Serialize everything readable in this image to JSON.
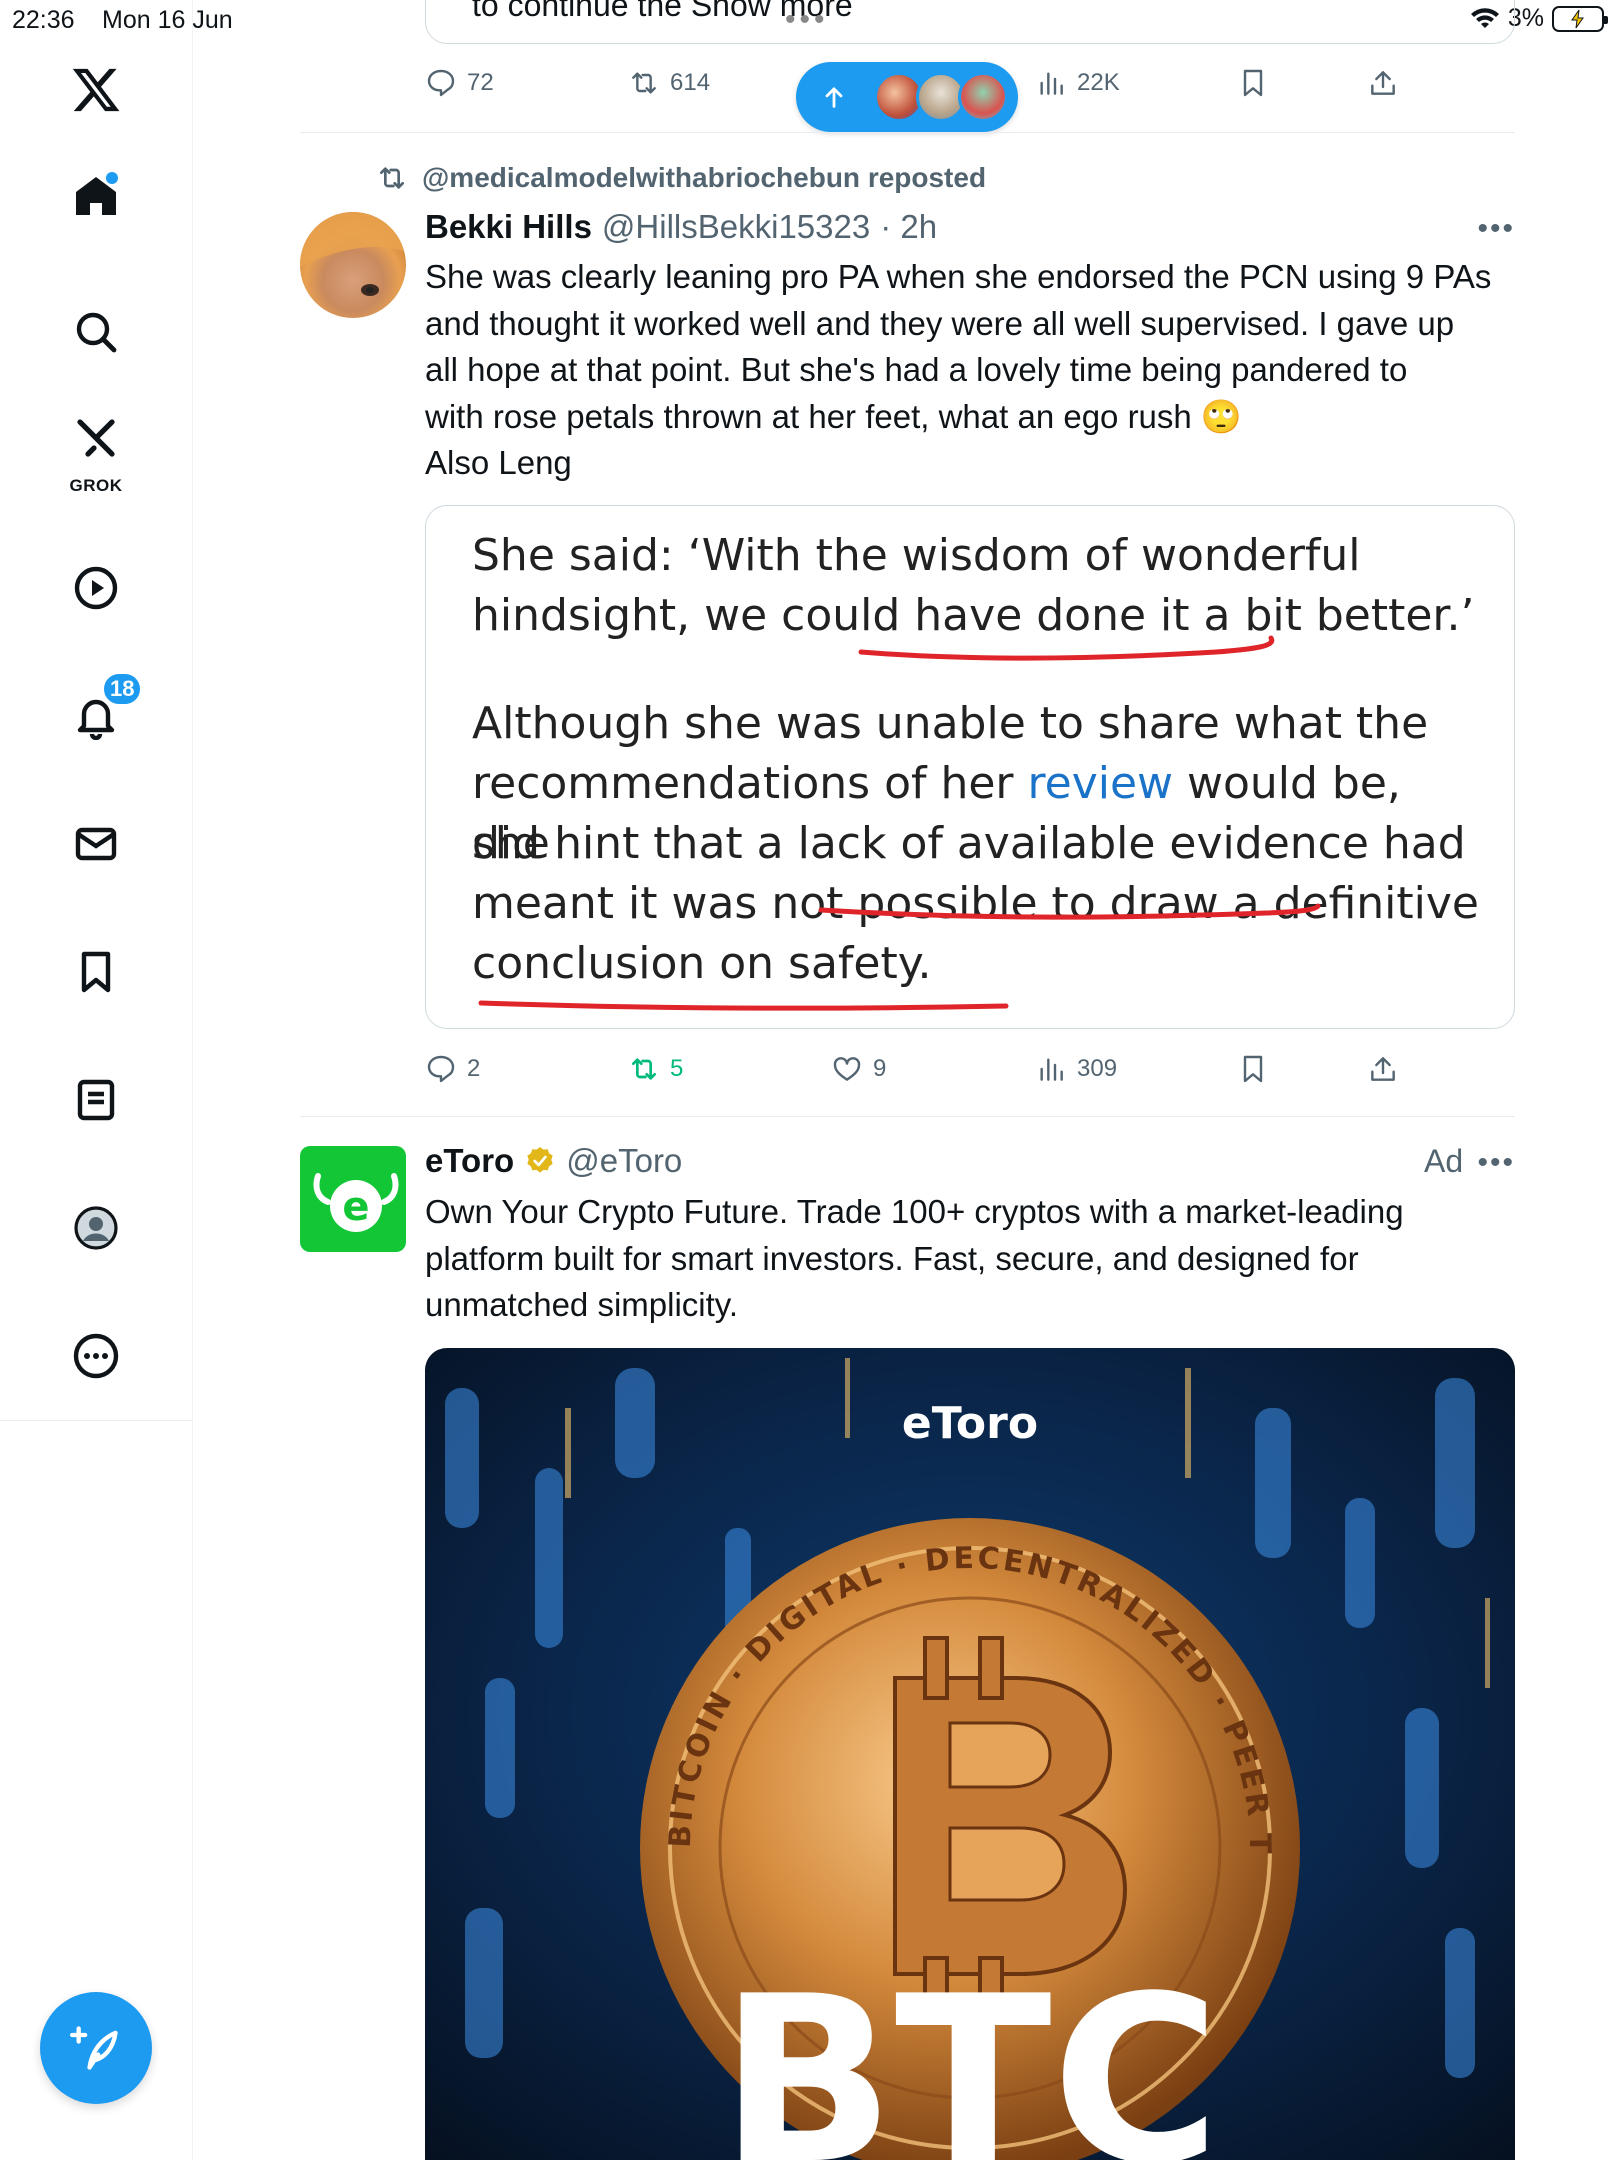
{
  "status_bar": {
    "time": "22:36",
    "date": "Mon 16 Jun",
    "battery": "3%"
  },
  "sidebar": {
    "grok_label": "GROK",
    "notifications_badge": "18",
    "items": [
      "home",
      "search",
      "grok",
      "videos",
      "notifications",
      "messages",
      "bookmarks",
      "lists",
      "profile",
      "more"
    ]
  },
  "top_tweet": {
    "truncated_text": "to continue the Show more",
    "reply_count": "72",
    "repost_count": "614",
    "view_count": "22K"
  },
  "reposted_tweet": {
    "repost_by": "@medicalmodelwithabriochebun reposted",
    "author_name": "Bekki Hills",
    "author_handle": "@HillsBekki15323",
    "time": "· 2h",
    "text_lines": [
      "She was clearly leaning pro PA when she endorsed the PCN using 9 PAs",
      "and thought it worked well and they were all well supervised. I gave up",
      "all hope at that point. But she's had a lovely time being pandered to",
      "with rose petals thrown at her feet, what an ego rush 🙄",
      "Also Leng"
    ],
    "quote_image": {
      "para1_lines": [
        "She said: ‘With the wisdom of wonderful",
        "hindsight, we could have done it a bit better.’"
      ],
      "para2_line1": "Although she was unable to share what the",
      "para2_line2_before": "recommendations of her ",
      "para2_link": "review",
      "para2_line2_after": " would be, she",
      "para2_line3": "did hint that a lack of available evidence had",
      "para2_line4": "meant it was not possible to draw a definitive",
      "para2_line5": "conclusion on safety."
    },
    "reply_count": "2",
    "repost_count": "5",
    "like_count": "9",
    "view_count": "309"
  },
  "ad_tweet": {
    "author_name": "eToro",
    "author_handle": "@eToro",
    "ad_label": "Ad",
    "text_lines": [
      "Own Your Crypto Future. Trade 100+ cryptos with a market-leading",
      "platform built for smart investors. Fast, secure, and designed for",
      "unmatched simplicity."
    ],
    "image_logo_text": "eToro",
    "image_big_text": "BTC",
    "coin_ring_text": "BITCOIN · DIGITAL · DECENTRALIZED · PEER TO PEER"
  },
  "colors": {
    "accent": "#1d9bf0",
    "repost_green": "#00ba7c",
    "etoro_green": "#13c636",
    "underline_red": "#e0252a"
  }
}
